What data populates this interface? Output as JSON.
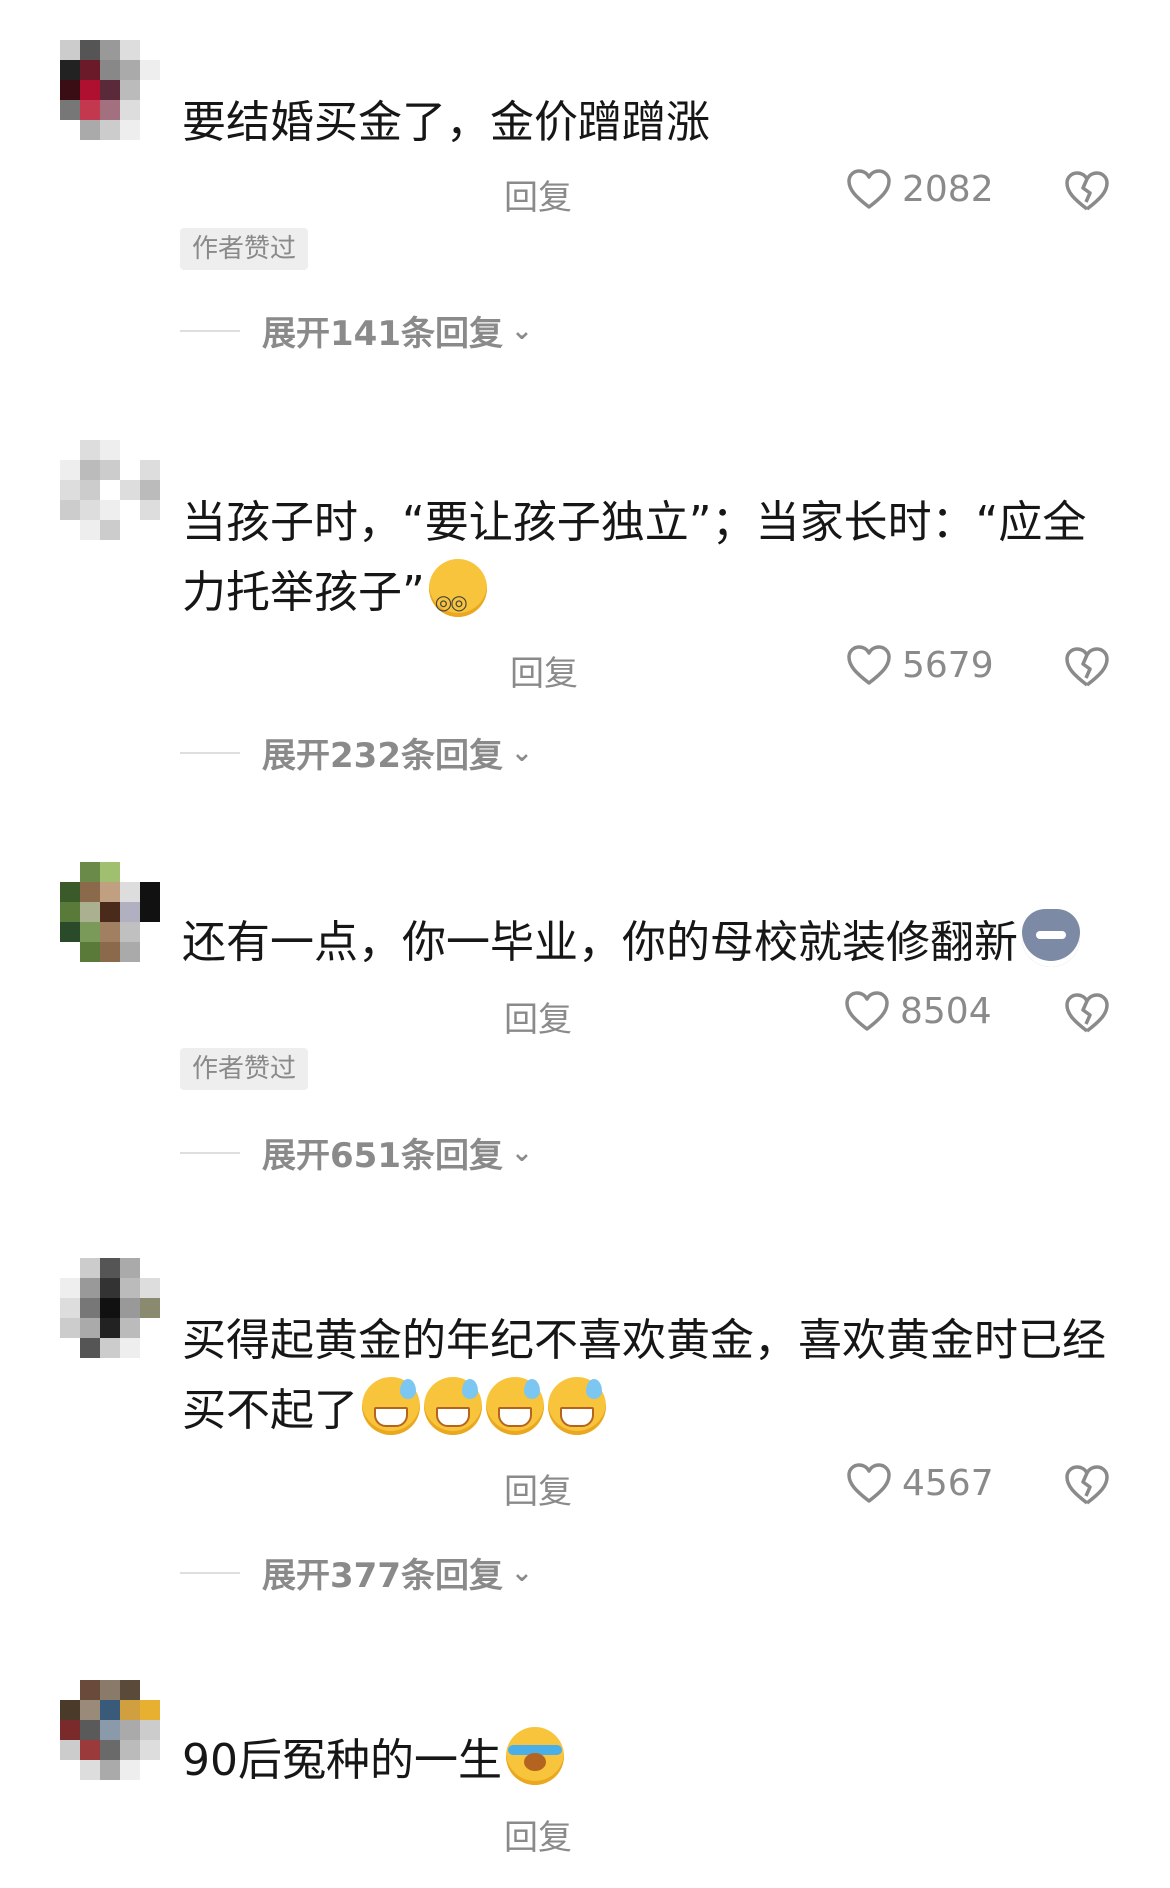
{
  "comments": [
    {
      "text": "要结婚买金了，金价蹭蹭涨",
      "text_lines": [
        "要结婚买金了，金价蹭蹭涨"
      ],
      "reply_label": "回复",
      "likes": "2082",
      "author_liked": "作者赞过",
      "expand": "展开141条回复"
    },
    {
      "text_lines": [
        "当孩子时，“要让孩子独立”；当家长时：“应全",
        "力托举孩子”"
      ],
      "emoji": [
        "dizzy"
      ],
      "reply_label": "回复",
      "likes": "5679",
      "expand": "展开232条回复"
    },
    {
      "text_lines": [
        "还有一点，你一毕业，你的母校就装修翻新"
      ],
      "emoji": [
        "wolf"
      ],
      "reply_label": "回复",
      "likes": "8504",
      "author_liked": "作者赞过",
      "expand": "展开651条回复"
    },
    {
      "text_lines": [
        "买得起黄金的年纪不喜欢黄金，喜欢黄金时已经",
        "买不起了"
      ],
      "emoji": [
        "grin-sweat",
        "grin-sweat",
        "grin-sweat",
        "grin-sweat"
      ],
      "reply_label": "回复",
      "likes": "4567",
      "expand": "展开377条回复"
    },
    {
      "text_lines": [
        "90后冤种的一生"
      ],
      "emoji": [
        "crying"
      ],
      "reply_label": "回复"
    }
  ],
  "icons": {
    "heart": "heart-outline-icon",
    "dislike": "broken-heart-icon",
    "chevron": "chevron-down-icon"
  },
  "colors": {
    "text": "#161616",
    "secondary": "#8a8a8a",
    "badge_bg": "#eeeeee",
    "divider": "#dedede"
  }
}
